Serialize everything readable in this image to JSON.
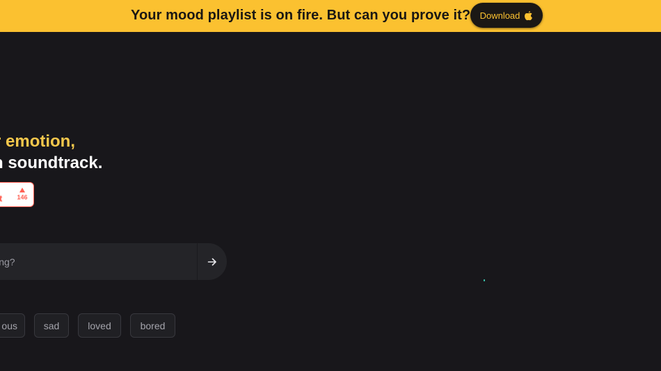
{
  "banner": {
    "text": "Your mood playlist is on fire. But can you prove it?",
    "download_label": "Download",
    "download_icon": "apple-icon",
    "background": "#fbc130"
  },
  "hero": {
    "line1": "r emotion,",
    "line2": "n soundtrack."
  },
  "product_hunt": {
    "label_partial": "t",
    "upvote_icon": "upvote-triangle-icon",
    "upvote_count": "146"
  },
  "mood_input": {
    "placeholder_partial": "ling?",
    "value": "",
    "submit_icon": "arrow-right-icon"
  },
  "mood_chips": [
    "ous",
    "sad",
    "loved",
    "bored"
  ],
  "colors": {
    "background": "#18171b",
    "accent": "#fbc130",
    "hero_highlight": "#f5c84c",
    "product_hunt": "#ff6154"
  }
}
